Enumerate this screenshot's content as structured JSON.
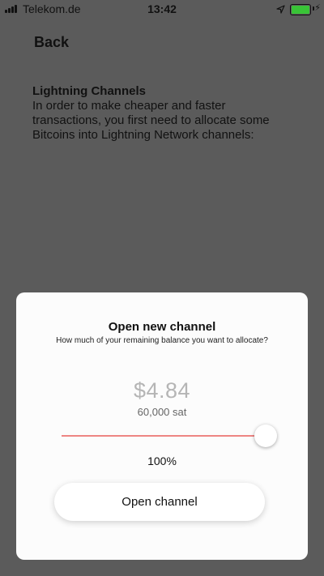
{
  "status_bar": {
    "carrier": "Telekom.de",
    "time": "13:42",
    "battery_level": 1.0,
    "colors": {
      "battery": "#39c437"
    }
  },
  "nav": {
    "back_label": "Back"
  },
  "intro": {
    "title": "Lightning Channels",
    "body": "In order to make cheaper and faster transactions, you first need to allocate some Bitcoins into Lightning Network channels:"
  },
  "modal": {
    "title": "Open new channel",
    "subtitle": "How much of your remaining balance you want to allocate?",
    "amount_fiat": "$4.84",
    "amount_sat": "60,000 sat",
    "slider_value": 1.0,
    "percent_label": "100%",
    "button_label": "Open channel",
    "colors": {
      "slider_track": "#ee8583"
    }
  }
}
